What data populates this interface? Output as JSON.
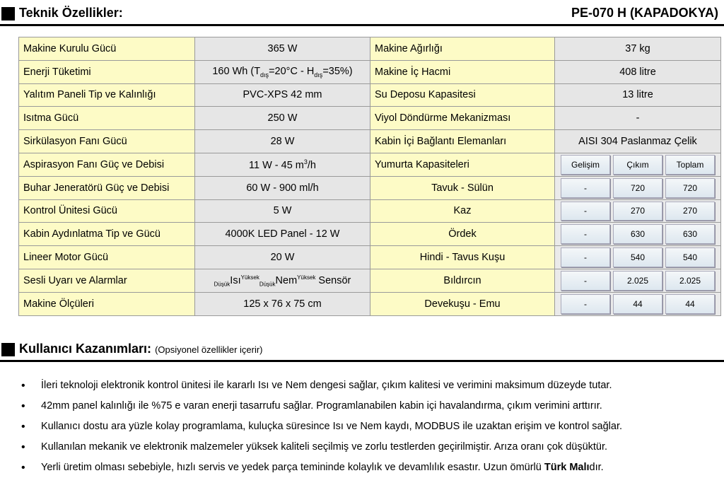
{
  "header": {
    "title": "Teknik Özellikler:",
    "model": "PE-070 H (KAPADOKYA)"
  },
  "specs_left": [
    {
      "label": "Makine Kurulu Gücü",
      "value": "365 W"
    },
    {
      "label": "Enerji Tüketimi",
      "value_parts": [
        "160 Wh (T",
        "dış",
        "=20°C - H",
        "dış",
        "=35%)"
      ]
    },
    {
      "label": "Yalıtım Paneli Tip ve Kalınlığı",
      "value": "PVC-XPS 42 mm"
    },
    {
      "label": "Isıtma Gücü",
      "value": "250 W"
    },
    {
      "label": "Sirkülasyon Fanı Gücü",
      "value": "28 W"
    },
    {
      "label": "Aspirasyon Fanı Güç ve Debisi",
      "value_parts": [
        "11 W - 45 m",
        "3",
        "/h"
      ]
    },
    {
      "label": "Buhar Jeneratörü Güç ve Debisi",
      "value": "60 W - 900 ml/h"
    },
    {
      "label": "Kontrol Ünitesi Gücü",
      "value": "5 W"
    },
    {
      "label": "Kabin Aydınlatma Tip ve Gücü",
      "value": "4000K LED Panel - 12 W"
    },
    {
      "label": "Lineer Motor Gücü",
      "value": "20 W"
    },
    {
      "label": "Sesli Uyarı ve Alarmlar",
      "value_parts": [
        "Düşük",
        "Isı",
        "Yüksek",
        "Düşük",
        "Nem",
        "Yüksek",
        " Sensör"
      ]
    },
    {
      "label": "Makine Ölçüleri",
      "value": "125 x 76 x 75 cm"
    }
  ],
  "specs_right": [
    {
      "label": "Makine Ağırlığı",
      "value": "37 kg"
    },
    {
      "label": "Makine İç Hacmi",
      "value": "408 litre"
    },
    {
      "label": "Su Deposu Kapasitesi",
      "value": "13 litre"
    },
    {
      "label": "Viyol Döndürme Mekanizması",
      "value": "-"
    },
    {
      "label": "Kabin İçi Bağlantı Elemanları",
      "value": "AISI 304 Paslanmaz Çelik"
    }
  ],
  "capacity": {
    "label": "Yumurta Kapasiteleri",
    "columns": [
      "Gelişim",
      "Çıkım",
      "Toplam"
    ],
    "rows": [
      {
        "bird": "Tavuk - Sülün",
        "values": [
          "-",
          "720",
          "720"
        ]
      },
      {
        "bird": "Kaz",
        "values": [
          "-",
          "270",
          "270"
        ]
      },
      {
        "bird": "Ördek",
        "values": [
          "-",
          "630",
          "630"
        ]
      },
      {
        "bird": "Hindi - Tavus Kuşu",
        "values": [
          "-",
          "540",
          "540"
        ]
      },
      {
        "bird": "Bıldırcın",
        "values": [
          "-",
          "2.025",
          "2.025"
        ]
      },
      {
        "bird": "Devekuşu - Emu",
        "values": [
          "-",
          "44",
          "44"
        ]
      }
    ]
  },
  "benefits": {
    "title": "Kullanıcı Kazanımları:",
    "subtitle": "(Opsiyonel özellikler içerir)",
    "items": [
      "İleri teknoloji elektronik kontrol ünitesi ile kararlı Isı ve Nem dengesi sağlar, çıkım kalitesi ve verimini maksimum düzeyde tutar.",
      "42mm panel kalınlığı ile %75 e varan enerji tasarrufu sağlar. Programlanabilen kabin içi havalandırma, çıkım verimini arttırır.",
      "Kullanıcı dostu ara yüzle kolay programlama, kuluçka süresince Isı ve Nem kaydı, MODBUS ile uzaktan erişim ve kontrol sağlar.",
      "Kullanılan mekanik ve elektronik malzemeler yüksek kaliteli seçilmiş ve zorlu testlerden geçirilmiştir. Arıza oranı çok düşüktür."
    ],
    "last_item": {
      "text": "Yerli üretim olması sebebiyle, hızlı servis ve yedek parça temininde kolaylık ve devamlılık esastır. Uzun ömürlü ",
      "bold": "Türk Malı",
      "end": "dır."
    }
  },
  "colors": {
    "label_bg": "#fdfbc6",
    "value_bg": "#e6e6e6"
  }
}
